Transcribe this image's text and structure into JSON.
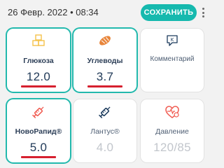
{
  "header": {
    "datetime": "26 Февр. 2022 • 08:34",
    "save_label": "СОХРАНИТЬ"
  },
  "cards": [
    {
      "label": "Глюкоза",
      "value": "12.0",
      "icon": "sugar-cubes-icon"
    },
    {
      "label": "Углеводы",
      "value": "3.7",
      "icon": "bread-icon"
    },
    {
      "label": "Комментарий",
      "value": "",
      "icon": "comment-icon"
    },
    {
      "label": "НовоРапид®",
      "value": "5.0",
      "icon": "syringe-icon"
    },
    {
      "label": "Лантус®",
      "value": "4.0",
      "icon": "syringe-icon"
    },
    {
      "label": "Давление",
      "value": "120/85",
      "icon": "heart-pressure-icon"
    }
  ],
  "colors": {
    "accent": "#16b9ae",
    "underline": "#d6202f",
    "glucose_icon": "#f4c24a",
    "carbs_icon": "#e8853b",
    "insulin_icon": "#f05a50",
    "lantus_icon": "#1b3a5c",
    "pressure_icon": "#f05a50"
  }
}
